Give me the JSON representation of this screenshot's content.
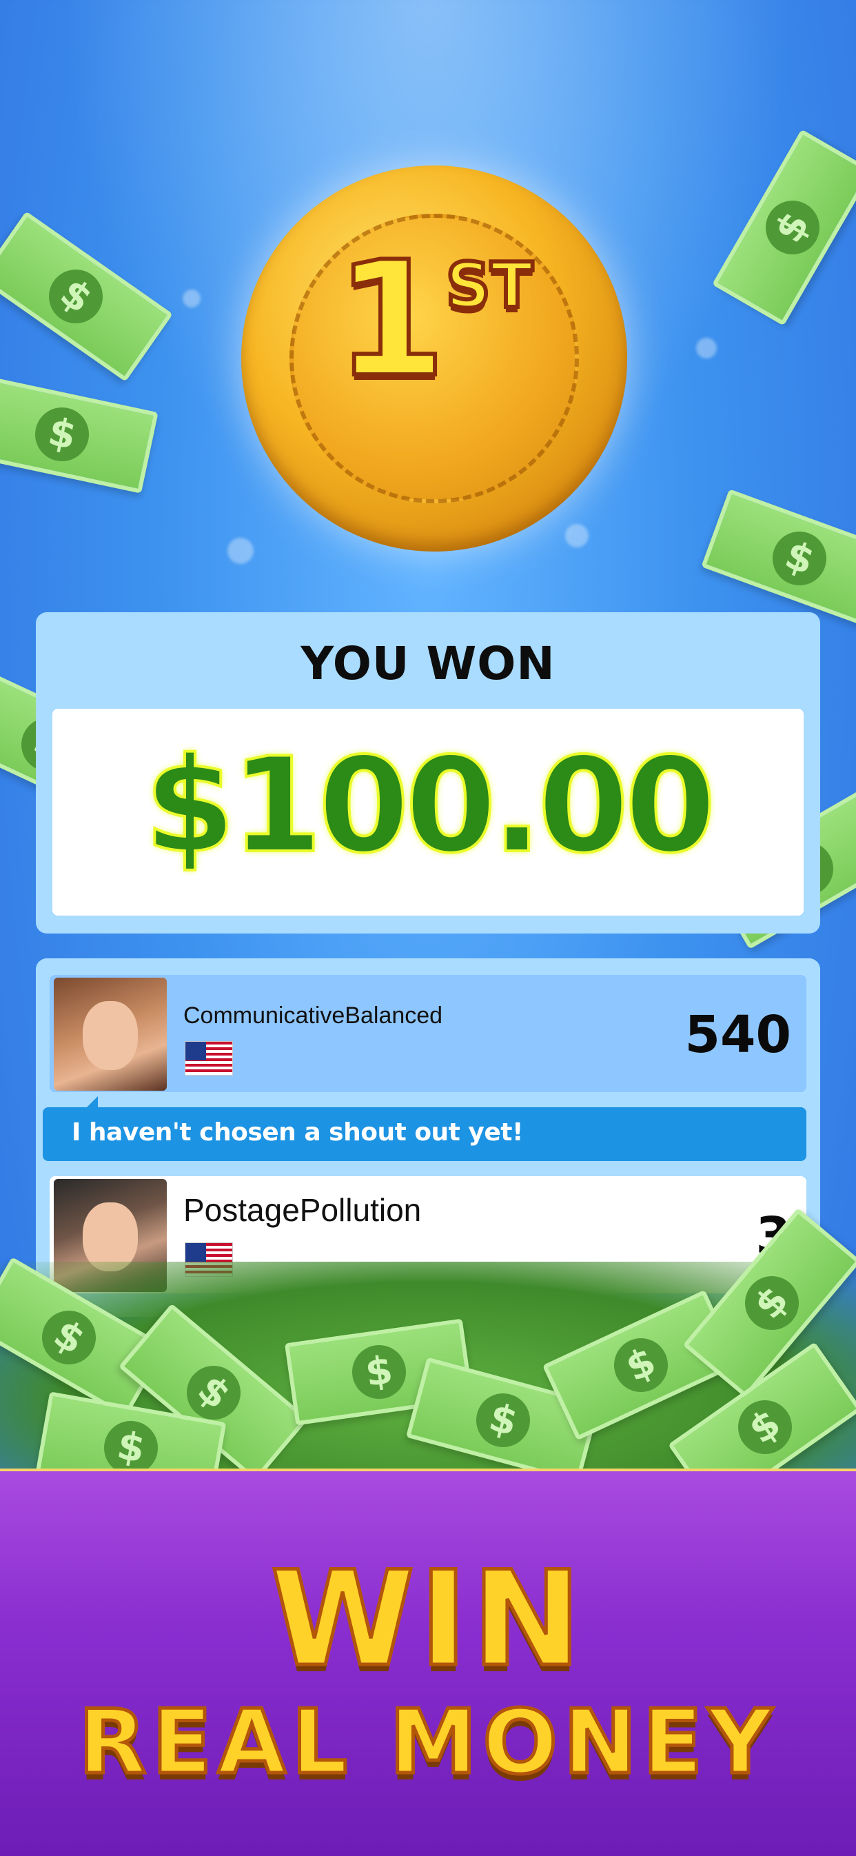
{
  "medal": {
    "rank": "1",
    "suffix": "ST"
  },
  "result": {
    "title": "YOU WON",
    "amount": "$100.00"
  },
  "leaderboard": {
    "rows": [
      {
        "name": "CommunicativeBalanced",
        "score": "540",
        "flag": "us-flag"
      },
      {
        "name": "PostagePollution",
        "score": "3",
        "flag": "us-flag"
      }
    ],
    "shout_out": "I haven't chosen a shout out yet!"
  },
  "banner": {
    "line1": "WIN",
    "line2": "REAL MONEY"
  },
  "bill_symbol": "$",
  "colors": {
    "accent_green": "#2c8a17",
    "banner_purple": "#8a2ed0",
    "gold": "#ffd22a"
  }
}
